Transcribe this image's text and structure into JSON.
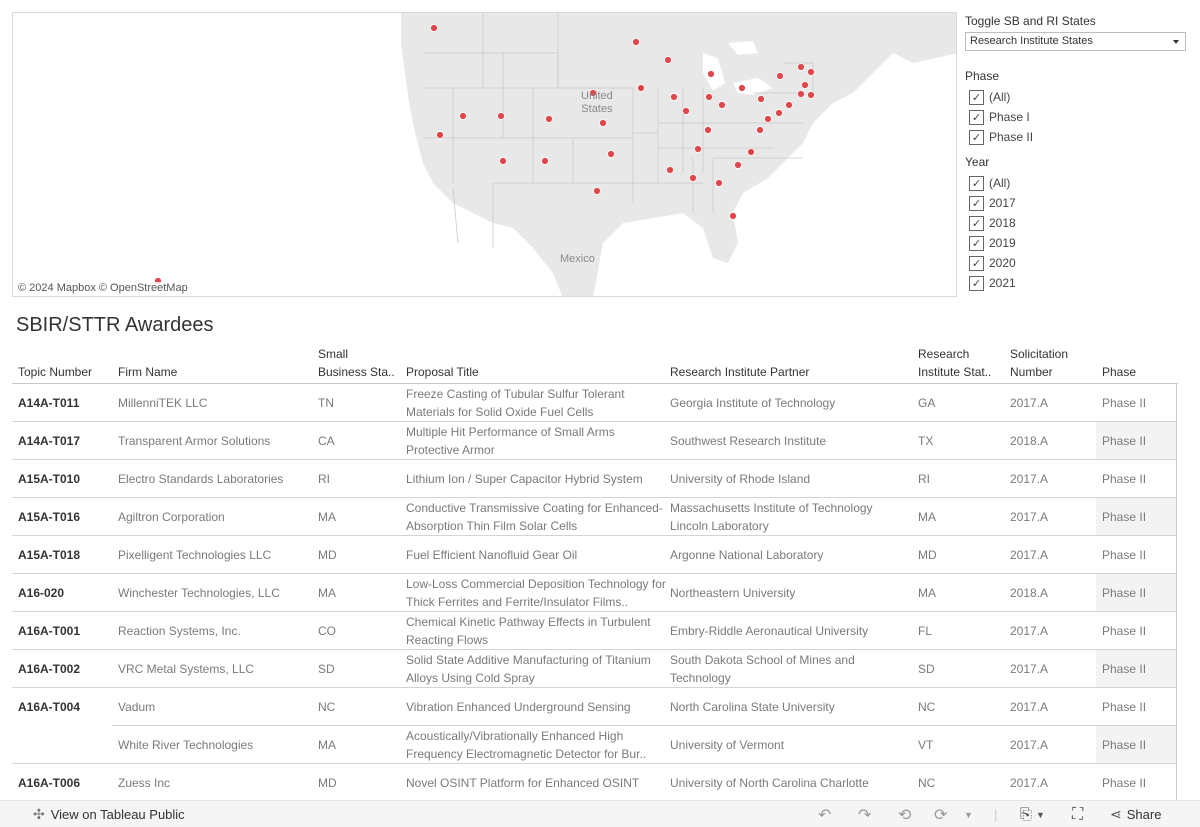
{
  "map": {
    "labels": {
      "country_us": "United States",
      "country_us_line1": "United",
      "country_us_line2": "States",
      "mexico": "Mexico"
    },
    "attribution": "© 2024 Mapbox  © OpenStreetMap",
    "marker_color": "#e0474c",
    "markers_states": [
      "WA",
      "ND",
      "MN",
      "WI",
      "SD",
      "MI",
      "NY",
      "VT",
      "NH",
      "MA",
      "RI",
      "CT",
      "NV",
      "UT",
      "CO",
      "NE",
      "KS",
      "CA",
      "IA",
      "IL",
      "IN",
      "OH",
      "PA",
      "NJ",
      "MD",
      "DE",
      "VA",
      "KY",
      "AZ",
      "NM",
      "OK",
      "TN",
      "NC",
      "SC",
      "MS",
      "AL",
      "GA",
      "TX",
      "FL",
      "HI"
    ]
  },
  "filters": {
    "toggle": {
      "title": "Toggle SB and RI States",
      "selected": "Research Institute States"
    },
    "phase": {
      "title": "Phase",
      "options": [
        {
          "label": "(All)",
          "checked": true
        },
        {
          "label": "Phase I",
          "checked": true
        },
        {
          "label": "Phase II",
          "checked": true
        }
      ]
    },
    "year": {
      "title": "Year",
      "options": [
        {
          "label": "(All)",
          "checked": true
        },
        {
          "label": "2017",
          "checked": true
        },
        {
          "label": "2018",
          "checked": true
        },
        {
          "label": "2019",
          "checked": true
        },
        {
          "label": "2020",
          "checked": true
        },
        {
          "label": "2021",
          "checked": true
        }
      ]
    }
  },
  "table": {
    "title": "SBIR/STTR Awardees",
    "headers": {
      "topic": "Topic Number",
      "firm": "Firm Name",
      "sb_state_1": "Small",
      "sb_state_2": "Business Sta..",
      "title": "Proposal Title",
      "ri_partner": "Research Institute Partner",
      "ri_state_1": "Research",
      "ri_state_2": "Institute Stat..",
      "solicitation_1": "Solicitation",
      "solicitation_2": "Number",
      "phase": "Phase"
    },
    "rows": [
      {
        "topic": "A14A-T011",
        "firm": "MillenniTEK LLC",
        "sb_state": "TN",
        "title": "Freeze Casting of Tubular Sulfur Tolerant Materials for Solid Oxide Fuel Cells",
        "ri_partner": "Georgia Institute of Technology",
        "ri_state": "GA",
        "solicitation": "2017.A",
        "phase": "Phase II"
      },
      {
        "topic": "A14A-T017",
        "firm": "Transparent Armor Solutions",
        "sb_state": "CA",
        "title": "Multiple Hit Performance of Small Arms Protective Armor",
        "ri_partner": "Southwest Research Institute",
        "ri_state": "TX",
        "solicitation": "2018.A",
        "phase": "Phase II"
      },
      {
        "topic": "A15A-T010",
        "firm": "Electro Standards Laboratories",
        "sb_state": "RI",
        "title": "Lithium Ion / Super Capacitor Hybrid System",
        "ri_partner": "University of Rhode Island",
        "ri_state": "RI",
        "solicitation": "2017.A",
        "phase": "Phase II"
      },
      {
        "topic": "A15A-T016",
        "firm": "Agiltron Corporation",
        "sb_state": "MA",
        "title": "Conductive Transmissive Coating for Enhanced-Absorption Thin Film Solar Cells",
        "ri_partner": "Massachusetts Institute of Technology Lincoln Laboratory",
        "ri_state": "MA",
        "solicitation": "2017.A",
        "phase": "Phase II"
      },
      {
        "topic": "A15A-T018",
        "firm": "Pixelligent Technologies LLC",
        "sb_state": "MD",
        "title": "Fuel Efficient Nanofluid Gear Oil",
        "ri_partner": "Argonne National Laboratory",
        "ri_state": "MD",
        "solicitation": "2017.A",
        "phase": "Phase II"
      },
      {
        "topic": "A16-020",
        "firm": "Winchester Technologies, LLC",
        "sb_state": "MA",
        "title": "Low-Loss Commercial Deposition Technology for Thick Ferrites and Ferrite/Insulator Films..",
        "ri_partner": "Northeastern University",
        "ri_state": "MA",
        "solicitation": "2018.A",
        "phase": "Phase II"
      },
      {
        "topic": "A16A-T001",
        "firm": "Reaction Systems, Inc.",
        "sb_state": "CO",
        "title": "Chemical Kinetic Pathway Effects in Turbulent Reacting Flows",
        "ri_partner": "Embry-Riddle Aeronautical University",
        "ri_state": "FL",
        "solicitation": "2017.A",
        "phase": "Phase II"
      },
      {
        "topic": "A16A-T002",
        "firm": "VRC Metal Systems, LLC",
        "sb_state": "SD",
        "title": "Solid State Additive Manufacturing of Titanium Alloys Using Cold Spray",
        "ri_partner": "South Dakota School of Mines and Technology",
        "ri_state": "SD",
        "solicitation": "2017.A",
        "phase": "Phase II"
      },
      {
        "topic": "A16A-T004",
        "firm": "Vadum",
        "sb_state": "NC",
        "title": "Vibration Enhanced Underground Sensing",
        "ri_partner": "North Carolina State University",
        "ri_state": "NC",
        "solicitation": "2017.A",
        "phase": "Phase II"
      },
      {
        "topic": "",
        "firm": "White River Technologies",
        "sb_state": "MA",
        "title": "Acoustically/Vibrationally Enhanced High Frequency Electromagnetic Detector for Bur..",
        "ri_partner": "University of Vermont",
        "ri_state": "VT",
        "solicitation": "2017.A",
        "phase": "Phase II"
      },
      {
        "topic": "A16A-T006",
        "firm": "Zuess Inc",
        "sb_state": "MD",
        "title": "Novel OSINT Platform for Enhanced OSINT",
        "ri_partner": "University of North Carolina Charlotte",
        "ri_state": "NC",
        "solicitation": "2017.A",
        "phase": "Phase II"
      }
    ]
  },
  "footer": {
    "view_on": "View on Tableau Public",
    "share": "Share"
  }
}
